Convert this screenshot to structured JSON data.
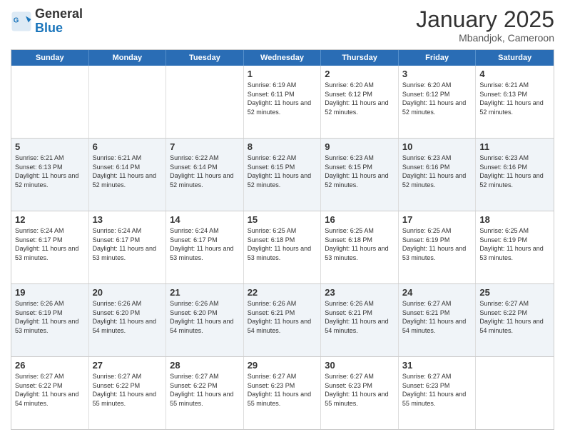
{
  "header": {
    "logo_line1": "General",
    "logo_line2": "Blue",
    "title": "January 2025",
    "subtitle": "Mbandjok, Cameroon"
  },
  "days_of_week": [
    "Sunday",
    "Monday",
    "Tuesday",
    "Wednesday",
    "Thursday",
    "Friday",
    "Saturday"
  ],
  "rows": [
    {
      "alt": false,
      "cells": [
        {
          "num": "",
          "info": ""
        },
        {
          "num": "",
          "info": ""
        },
        {
          "num": "",
          "info": ""
        },
        {
          "num": "1",
          "info": "Sunrise: 6:19 AM\nSunset: 6:11 PM\nDaylight: 11 hours and 52 minutes."
        },
        {
          "num": "2",
          "info": "Sunrise: 6:20 AM\nSunset: 6:12 PM\nDaylight: 11 hours and 52 minutes."
        },
        {
          "num": "3",
          "info": "Sunrise: 6:20 AM\nSunset: 6:12 PM\nDaylight: 11 hours and 52 minutes."
        },
        {
          "num": "4",
          "info": "Sunrise: 6:21 AM\nSunset: 6:13 PM\nDaylight: 11 hours and 52 minutes."
        }
      ]
    },
    {
      "alt": true,
      "cells": [
        {
          "num": "5",
          "info": "Sunrise: 6:21 AM\nSunset: 6:13 PM\nDaylight: 11 hours and 52 minutes."
        },
        {
          "num": "6",
          "info": "Sunrise: 6:21 AM\nSunset: 6:14 PM\nDaylight: 11 hours and 52 minutes."
        },
        {
          "num": "7",
          "info": "Sunrise: 6:22 AM\nSunset: 6:14 PM\nDaylight: 11 hours and 52 minutes."
        },
        {
          "num": "8",
          "info": "Sunrise: 6:22 AM\nSunset: 6:15 PM\nDaylight: 11 hours and 52 minutes."
        },
        {
          "num": "9",
          "info": "Sunrise: 6:23 AM\nSunset: 6:15 PM\nDaylight: 11 hours and 52 minutes."
        },
        {
          "num": "10",
          "info": "Sunrise: 6:23 AM\nSunset: 6:16 PM\nDaylight: 11 hours and 52 minutes."
        },
        {
          "num": "11",
          "info": "Sunrise: 6:23 AM\nSunset: 6:16 PM\nDaylight: 11 hours and 52 minutes."
        }
      ]
    },
    {
      "alt": false,
      "cells": [
        {
          "num": "12",
          "info": "Sunrise: 6:24 AM\nSunset: 6:17 PM\nDaylight: 11 hours and 53 minutes."
        },
        {
          "num": "13",
          "info": "Sunrise: 6:24 AM\nSunset: 6:17 PM\nDaylight: 11 hours and 53 minutes."
        },
        {
          "num": "14",
          "info": "Sunrise: 6:24 AM\nSunset: 6:17 PM\nDaylight: 11 hours and 53 minutes."
        },
        {
          "num": "15",
          "info": "Sunrise: 6:25 AM\nSunset: 6:18 PM\nDaylight: 11 hours and 53 minutes."
        },
        {
          "num": "16",
          "info": "Sunrise: 6:25 AM\nSunset: 6:18 PM\nDaylight: 11 hours and 53 minutes."
        },
        {
          "num": "17",
          "info": "Sunrise: 6:25 AM\nSunset: 6:19 PM\nDaylight: 11 hours and 53 minutes."
        },
        {
          "num": "18",
          "info": "Sunrise: 6:25 AM\nSunset: 6:19 PM\nDaylight: 11 hours and 53 minutes."
        }
      ]
    },
    {
      "alt": true,
      "cells": [
        {
          "num": "19",
          "info": "Sunrise: 6:26 AM\nSunset: 6:19 PM\nDaylight: 11 hours and 53 minutes."
        },
        {
          "num": "20",
          "info": "Sunrise: 6:26 AM\nSunset: 6:20 PM\nDaylight: 11 hours and 54 minutes."
        },
        {
          "num": "21",
          "info": "Sunrise: 6:26 AM\nSunset: 6:20 PM\nDaylight: 11 hours and 54 minutes."
        },
        {
          "num": "22",
          "info": "Sunrise: 6:26 AM\nSunset: 6:21 PM\nDaylight: 11 hours and 54 minutes."
        },
        {
          "num": "23",
          "info": "Sunrise: 6:26 AM\nSunset: 6:21 PM\nDaylight: 11 hours and 54 minutes."
        },
        {
          "num": "24",
          "info": "Sunrise: 6:27 AM\nSunset: 6:21 PM\nDaylight: 11 hours and 54 minutes."
        },
        {
          "num": "25",
          "info": "Sunrise: 6:27 AM\nSunset: 6:22 PM\nDaylight: 11 hours and 54 minutes."
        }
      ]
    },
    {
      "alt": false,
      "cells": [
        {
          "num": "26",
          "info": "Sunrise: 6:27 AM\nSunset: 6:22 PM\nDaylight: 11 hours and 54 minutes."
        },
        {
          "num": "27",
          "info": "Sunrise: 6:27 AM\nSunset: 6:22 PM\nDaylight: 11 hours and 55 minutes."
        },
        {
          "num": "28",
          "info": "Sunrise: 6:27 AM\nSunset: 6:22 PM\nDaylight: 11 hours and 55 minutes."
        },
        {
          "num": "29",
          "info": "Sunrise: 6:27 AM\nSunset: 6:23 PM\nDaylight: 11 hours and 55 minutes."
        },
        {
          "num": "30",
          "info": "Sunrise: 6:27 AM\nSunset: 6:23 PM\nDaylight: 11 hours and 55 minutes."
        },
        {
          "num": "31",
          "info": "Sunrise: 6:27 AM\nSunset: 6:23 PM\nDaylight: 11 hours and 55 minutes."
        },
        {
          "num": "",
          "info": ""
        }
      ]
    }
  ]
}
